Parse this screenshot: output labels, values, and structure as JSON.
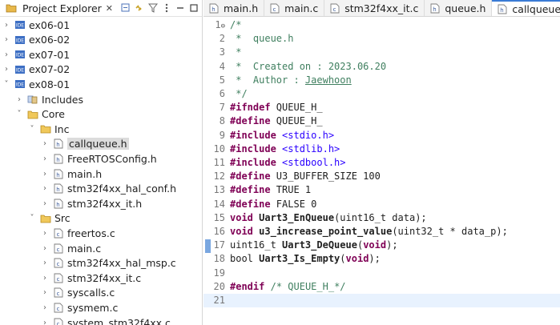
{
  "explorer": {
    "title": "Project Explorer",
    "close": "✕",
    "toolbar": [
      "collapse-all-icon",
      "link-editor-icon",
      "filter-icon",
      "view-menu-icon",
      "minimize-icon",
      "maximize-icon"
    ],
    "tree": [
      {
        "label": "ex06-01",
        "depth": 0,
        "twist": "›",
        "icon": "project-icon"
      },
      {
        "label": "ex06-02",
        "depth": 0,
        "twist": "›",
        "icon": "project-icon"
      },
      {
        "label": "ex07-01",
        "depth": 0,
        "twist": "›",
        "icon": "project-icon"
      },
      {
        "label": "ex07-02",
        "depth": 0,
        "twist": "›",
        "icon": "project-icon"
      },
      {
        "label": "ex08-01",
        "depth": 0,
        "twist": "˅",
        "icon": "project-icon"
      },
      {
        "label": "Includes",
        "depth": 1,
        "twist": "›",
        "icon": "includes-icon"
      },
      {
        "label": "Core",
        "depth": 1,
        "twist": "˅",
        "icon": "folder-icon"
      },
      {
        "label": "Inc",
        "depth": 2,
        "twist": "˅",
        "icon": "folder-icon"
      },
      {
        "label": "callqueue.h",
        "depth": 3,
        "twist": "›",
        "icon": "header-file-icon",
        "selected": true
      },
      {
        "label": "FreeRTOSConfig.h",
        "depth": 3,
        "twist": "›",
        "icon": "header-file-icon"
      },
      {
        "label": "main.h",
        "depth": 3,
        "twist": "›",
        "icon": "header-file-icon"
      },
      {
        "label": "stm32f4xx_hal_conf.h",
        "depth": 3,
        "twist": "›",
        "icon": "header-file-icon"
      },
      {
        "label": "stm32f4xx_it.h",
        "depth": 3,
        "twist": "›",
        "icon": "header-file-icon"
      },
      {
        "label": "Src",
        "depth": 2,
        "twist": "˅",
        "icon": "folder-icon"
      },
      {
        "label": "freertos.c",
        "depth": 3,
        "twist": "›",
        "icon": "source-file-icon"
      },
      {
        "label": "main.c",
        "depth": 3,
        "twist": "›",
        "icon": "source-file-icon"
      },
      {
        "label": "stm32f4xx_hal_msp.c",
        "depth": 3,
        "twist": "›",
        "icon": "source-file-icon"
      },
      {
        "label": "stm32f4xx_it.c",
        "depth": 3,
        "twist": "›",
        "icon": "source-file-icon"
      },
      {
        "label": "syscalls.c",
        "depth": 3,
        "twist": "›",
        "icon": "source-file-icon"
      },
      {
        "label": "sysmem.c",
        "depth": 3,
        "twist": "›",
        "icon": "source-file-icon"
      },
      {
        "label": "system_stm32f4xx.c",
        "depth": 3,
        "twist": "›",
        "icon": "source-file-icon"
      }
    ]
  },
  "editor": {
    "tabs": [
      {
        "label": "main.h",
        "icon": "header-file-icon"
      },
      {
        "label": "main.c",
        "icon": "source-file-icon"
      },
      {
        "label": "stm32f4xx_it.c",
        "icon": "source-file-icon"
      },
      {
        "label": "queue.h",
        "icon": "header-file-icon"
      },
      {
        "label": "callqueue.h",
        "icon": "header-file-icon",
        "active": true,
        "close": "✕"
      }
    ],
    "current_line": 21,
    "lines": [
      {
        "n": "1",
        "fold": "⊖",
        "parts": [
          [
            "c",
            "/*"
          ]
        ]
      },
      {
        "n": "2",
        "parts": [
          [
            "c",
            " *  queue.h"
          ]
        ]
      },
      {
        "n": "3",
        "parts": [
          [
            "c",
            " *"
          ]
        ]
      },
      {
        "n": "4",
        "parts": [
          [
            "c",
            " *  Created on : 2023.06.20"
          ]
        ]
      },
      {
        "n": "5",
        "parts": [
          [
            "c",
            " *  Author : "
          ],
          [
            "cu",
            "Jaewhoon"
          ]
        ]
      },
      {
        "n": "6",
        "parts": [
          [
            "c",
            " */"
          ]
        ]
      },
      {
        "n": "7",
        "parts": [
          [
            "k",
            "#ifndef"
          ],
          [
            "",
            " QUEUE_H_"
          ]
        ]
      },
      {
        "n": "8",
        "parts": [
          [
            "k",
            "#define"
          ],
          [
            "",
            " QUEUE_H_"
          ]
        ]
      },
      {
        "n": "9",
        "parts": [
          [
            "k",
            "#include"
          ],
          [
            "",
            " "
          ],
          [
            "s",
            "<stdio.h>"
          ]
        ]
      },
      {
        "n": "10",
        "parts": [
          [
            "k",
            "#include"
          ],
          [
            "",
            " "
          ],
          [
            "s",
            "<stdlib.h>"
          ]
        ]
      },
      {
        "n": "11",
        "parts": [
          [
            "k",
            "#include"
          ],
          [
            "",
            " "
          ],
          [
            "s",
            "<stdbool.h>"
          ]
        ]
      },
      {
        "n": "12",
        "parts": [
          [
            "k",
            "#define"
          ],
          [
            "",
            " U3_BUFFER_SIZE 100"
          ]
        ]
      },
      {
        "n": "13",
        "parts": [
          [
            "k",
            "#define"
          ],
          [
            "",
            " TRUE 1"
          ]
        ]
      },
      {
        "n": "14",
        "parts": [
          [
            "k",
            "#define"
          ],
          [
            "",
            " FALSE 0"
          ]
        ]
      },
      {
        "n": "15",
        "parts": [
          [
            "k",
            "void"
          ],
          [
            "",
            " "
          ],
          [
            "b",
            "Uart3_EnQueue"
          ],
          [
            "",
            "(uint16_t data);"
          ]
        ]
      },
      {
        "n": "16",
        "parts": [
          [
            "k",
            "void"
          ],
          [
            "",
            " "
          ],
          [
            "b",
            "u3_increase_point_value"
          ],
          [
            "",
            "(uint32_t * data_p);"
          ]
        ]
      },
      {
        "n": "17",
        "parts": [
          [
            "",
            "uint16_t "
          ],
          [
            "b",
            "Uart3_DeQueue"
          ],
          [
            "",
            "("
          ],
          [
            "k",
            "void"
          ],
          [
            "",
            ");"
          ]
        ]
      },
      {
        "n": "18",
        "parts": [
          [
            "",
            "bool "
          ],
          [
            "b",
            "Uart3_Is_Empty"
          ],
          [
            "",
            "("
          ],
          [
            "k",
            "void"
          ],
          [
            "",
            ");"
          ]
        ]
      },
      {
        "n": "19",
        "parts": [
          [
            "",
            ""
          ]
        ]
      },
      {
        "n": "20",
        "parts": [
          [
            "k",
            "#endif"
          ],
          [
            "",
            " "
          ],
          [
            "c",
            "/* QUEUE_H_*/"
          ]
        ]
      },
      {
        "n": "21",
        "parts": [
          [
            "",
            ""
          ]
        ]
      }
    ]
  },
  "colors": {
    "keyword": "#7f0055",
    "comment": "#3f7f5f",
    "string": "#2a00ff",
    "current_line": "#e8f2fe",
    "tab_accent": "#3a7bd5"
  }
}
